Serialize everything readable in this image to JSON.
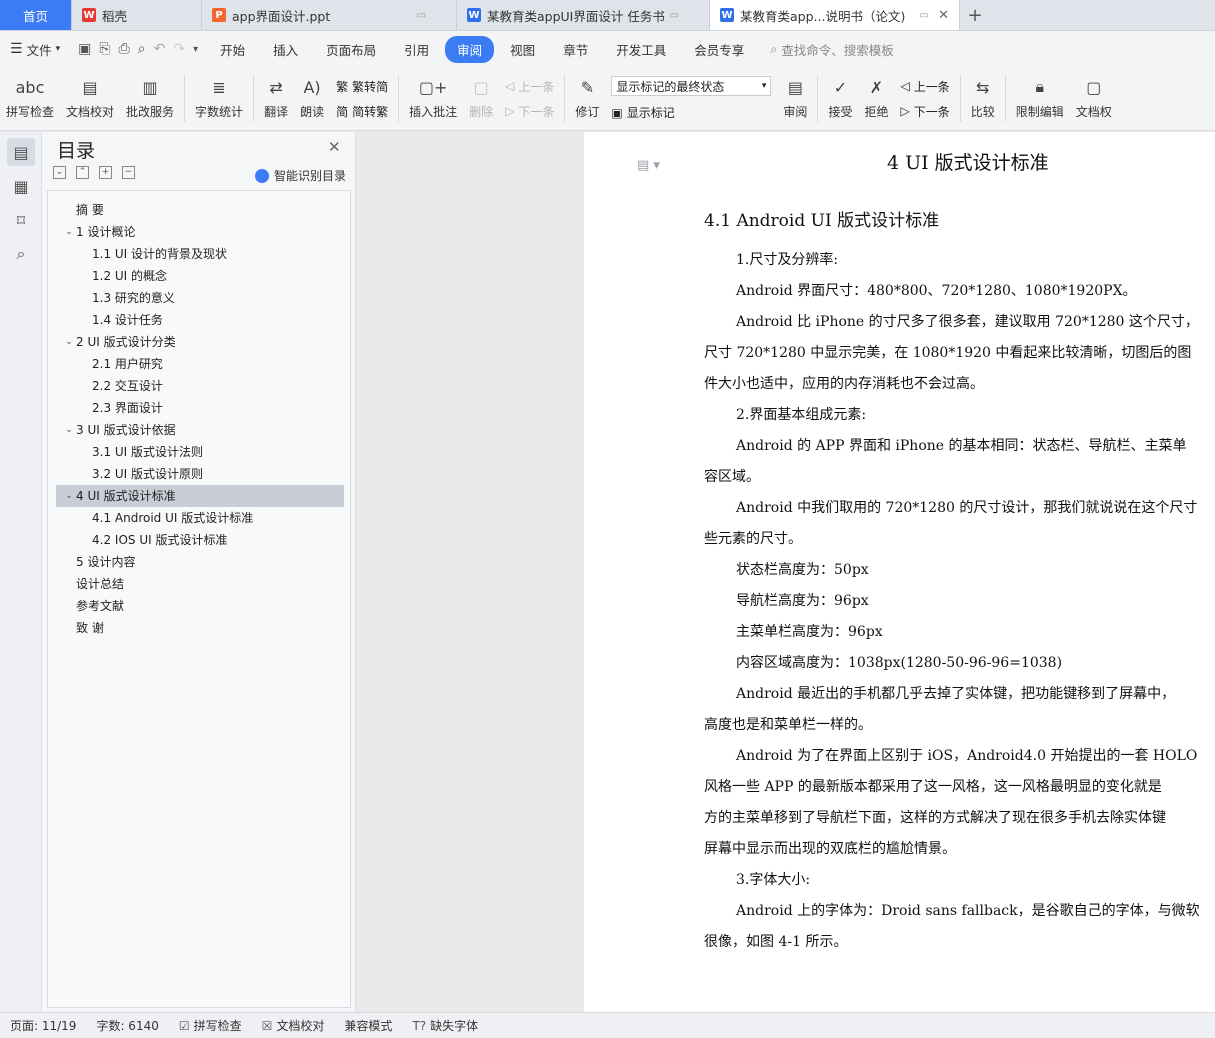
{
  "tabs": [
    {
      "label": "首页",
      "icon": "home"
    },
    {
      "label": "稻壳",
      "icon": "daoke-logo-icon"
    },
    {
      "label": "app界面设计.ppt",
      "icon": "ppt-file-icon"
    },
    {
      "label": "某教育类appUI界面设计 任务书",
      "icon": "word-file-icon"
    },
    {
      "label": "某教育类app...说明书（论文)",
      "icon": "word-file-icon"
    }
  ],
  "menubar": {
    "file_label": "文件",
    "items": [
      "开始",
      "插入",
      "页面布局",
      "引用",
      "审阅",
      "视图",
      "章节",
      "开发工具",
      "会员专享"
    ],
    "active": "审阅",
    "search_placeholder": "查找命令、搜索模板"
  },
  "ribbon": {
    "spell_check": "拼写检查",
    "doc_proof": "文档校对",
    "batch_service": "批改服务",
    "word_count": "字数统计",
    "translate": "翻译",
    "read_aloud": "朗读",
    "to_traditional": "繁转简",
    "to_simplified": "简转繁",
    "insert_comment": "插入批注",
    "delete": "删除",
    "prev_comment": "上一条",
    "next_comment": "下一条",
    "revise": "修订",
    "markup_state": "显示标记的最终状态",
    "show_markup": "显示标记",
    "review": "审阅",
    "accept": "接受",
    "reject": "拒绝",
    "prev_change": "上一条",
    "next_change": "下一条",
    "compare": "比较",
    "restrict_edit": "限制编辑",
    "doc_perm": "文档权"
  },
  "toc": {
    "title": "目录",
    "smart_label": "智能识别目录",
    "items": [
      {
        "text": "摘    要",
        "level": "top"
      },
      {
        "text": "1  设计概论",
        "level": "lv1",
        "caret": "v"
      },
      {
        "text": "1.1 UI 设计的背景及现状",
        "level": "lv2"
      },
      {
        "text": "1.2 UI 的概念",
        "level": "lv2"
      },
      {
        "text": "1.3 研究的意义",
        "level": "lv2"
      },
      {
        "text": "1.4 设计任务",
        "level": "lv2"
      },
      {
        "text": "2 UI 版式设计分类",
        "level": "lv1",
        "caret": "v"
      },
      {
        "text": "2.1 用户研究",
        "level": "lv2"
      },
      {
        "text": "2.2  交互设计",
        "level": "lv2"
      },
      {
        "text": "2.3  界面设计",
        "level": "lv2"
      },
      {
        "text": "3 UI 版式设计依据",
        "level": "lv1",
        "caret": "v"
      },
      {
        "text": "3.1 UI 版式设计法则",
        "level": "lv2"
      },
      {
        "text": "3.2 UI 版式设计原则",
        "level": "lv2"
      },
      {
        "text": "4 UI 版式设计标准",
        "level": "lv1",
        "caret": "v",
        "selected": true
      },
      {
        "text": "4.1 Android UI 版式设计标准",
        "level": "lv2"
      },
      {
        "text": "4.2 IOS UI 版式设计标准",
        "level": "lv2"
      },
      {
        "text": "5  设计内容",
        "level": "top"
      },
      {
        "text": "设计总结",
        "level": "top"
      },
      {
        "text": "参考文献",
        "level": "top"
      },
      {
        "text": "致    谢",
        "level": "top"
      }
    ]
  },
  "document": {
    "heading1": "4 UI 版式设计标准",
    "heading2": "4.1 Android UI 版式设计标准",
    "lines": [
      {
        "text": "1.尺寸及分辨率:",
        "indent": true
      },
      {
        "text": "Android 界面尺寸：480*800、720*1280、1080*1920PX。",
        "indent": true
      },
      {
        "text": "Android 比 iPhone 的寸尺多了很多套，建议取用 720*1280 这个尺寸，",
        "indent": true
      },
      {
        "text": "尺寸 720*1280 中显示完美，在 1080*1920 中看起来比较清晰，切图后的图",
        "indent": false
      },
      {
        "text": "件大小也适中，应用的内存消耗也不会过高。",
        "indent": false
      },
      {
        "text": "2.界面基本组成元素:",
        "indent": true
      },
      {
        "text": "Android 的 APP 界面和 iPhone 的基本相同：状态栏、导航栏、主菜单",
        "indent": true
      },
      {
        "text": "容区域。",
        "indent": false
      },
      {
        "text": "Android 中我们取用的 720*1280 的尺寸设计，那我们就说说在这个尺寸",
        "indent": true
      },
      {
        "text": "些元素的尺寸。",
        "indent": false
      },
      {
        "text": "状态栏高度为：50px",
        "indent": true
      },
      {
        "text": "导航栏高度为：96px",
        "indent": true
      },
      {
        "text": "主菜单栏高度为：96px",
        "indent": true
      },
      {
        "text": "内容区域高度为：1038px(1280-50-96-96=1038)",
        "indent": true
      },
      {
        "text": "Android 最近出的手机都几乎去掉了实体键，把功能键移到了屏幕中，",
        "indent": true
      },
      {
        "text": "高度也是和菜单栏一样的。",
        "indent": false
      },
      {
        "text": "Android 为了在界面上区别于 iOS，Android4.0 开始提出的一套 HOLO",
        "indent": true
      },
      {
        "text": "风格一些 APP 的最新版本都采用了这一风格，这一风格最明显的变化就是",
        "indent": false
      },
      {
        "text": "方的主菜单移到了导航栏下面，这样的方式解决了现在很多手机去除实体键",
        "indent": false
      },
      {
        "text": "屏幕中显示而出现的双底栏的尴尬情景。",
        "indent": false
      },
      {
        "text": "3.字体大小:",
        "indent": true
      },
      {
        "text": "Android 上的字体为：Droid sans fallback，是谷歌自己的字体，与微软",
        "indent": true
      },
      {
        "text": "很像，如图 4-1 所示。",
        "indent": false
      }
    ]
  },
  "statusbar": {
    "page": "页面: 11/19",
    "words": "字数: 6140",
    "spell": "拼写检查",
    "proof": "文档校对",
    "compat": "兼容模式",
    "missing_font": "缺失字体"
  }
}
